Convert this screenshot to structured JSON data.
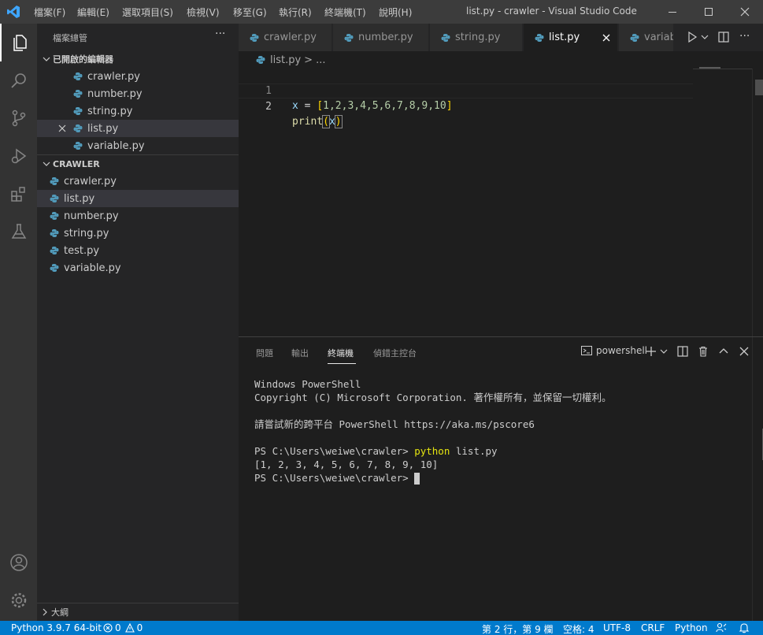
{
  "window": {
    "title": "list.py - crawler - Visual Studio Code",
    "menu": [
      "檔案(F)",
      "編輯(E)",
      "選取項目(S)",
      "檢視(V)",
      "移至(G)",
      "執行(R)",
      "終端機(T)",
      "說明(H)"
    ]
  },
  "sidebar": {
    "header": "檔案總管",
    "more": "···",
    "open_editors_title": "已開啟的編輯器",
    "open_editors": [
      "crawler.py",
      "number.py",
      "string.py",
      "list.py",
      "variable.py"
    ],
    "folder_title": "CRAWLER",
    "files": [
      "crawler.py",
      "list.py",
      "number.py",
      "string.py",
      "test.py",
      "variable.py"
    ],
    "outline": "大綱"
  },
  "tabs": [
    "crawler.py",
    "number.py",
    "string.py",
    "list.py",
    "variable.py"
  ],
  "active_tab": "list.py",
  "breadcrumb": {
    "file": "list.py",
    "sep": ">",
    "more": "..."
  },
  "editor": {
    "line1_no": "1",
    "line2_no": "2",
    "line1": {
      "var": "x",
      "op": " = ",
      "lb": "[",
      "nums": "1,2,3,4,5,6,7,8,9,10",
      "rb": "]"
    },
    "line2": {
      "fn": "print",
      "lp": "(",
      "arg": "x",
      "rp": ")"
    }
  },
  "panel": {
    "tabs": [
      "問題",
      "輸出",
      "終端機",
      "偵錯主控台"
    ],
    "active": "終端機",
    "shell": "powershell",
    "terminal": {
      "l1": "Windows PowerShell",
      "l2": "Copyright (C) Microsoft Corporation. 著作權所有，並保留一切權利。",
      "l3": "請嘗試新的跨平台 PowerShell https://aka.ms/pscore6",
      "prompt": "PS C:\\Users\\weiwe\\crawler> ",
      "cmd": "python",
      "cmd_arg": " list.py",
      "output": "[1, 2, 3, 4, 5, 6, 7, 8, 9, 10]",
      "prompt2": "PS C:\\Users\\weiwe\\crawler> "
    }
  },
  "status": {
    "python": "Python 3.9.7 64-bit",
    "errors": "0",
    "warnings": "0",
    "position": "第 2 行，第 9 欄",
    "spaces": "空格: 4",
    "encoding": "UTF-8",
    "eol": "CRLF",
    "language": "Python"
  },
  "colors": {
    "accent": "#007acc",
    "python_icon": "#519aba",
    "terminal_cmd": "#e5e510"
  }
}
